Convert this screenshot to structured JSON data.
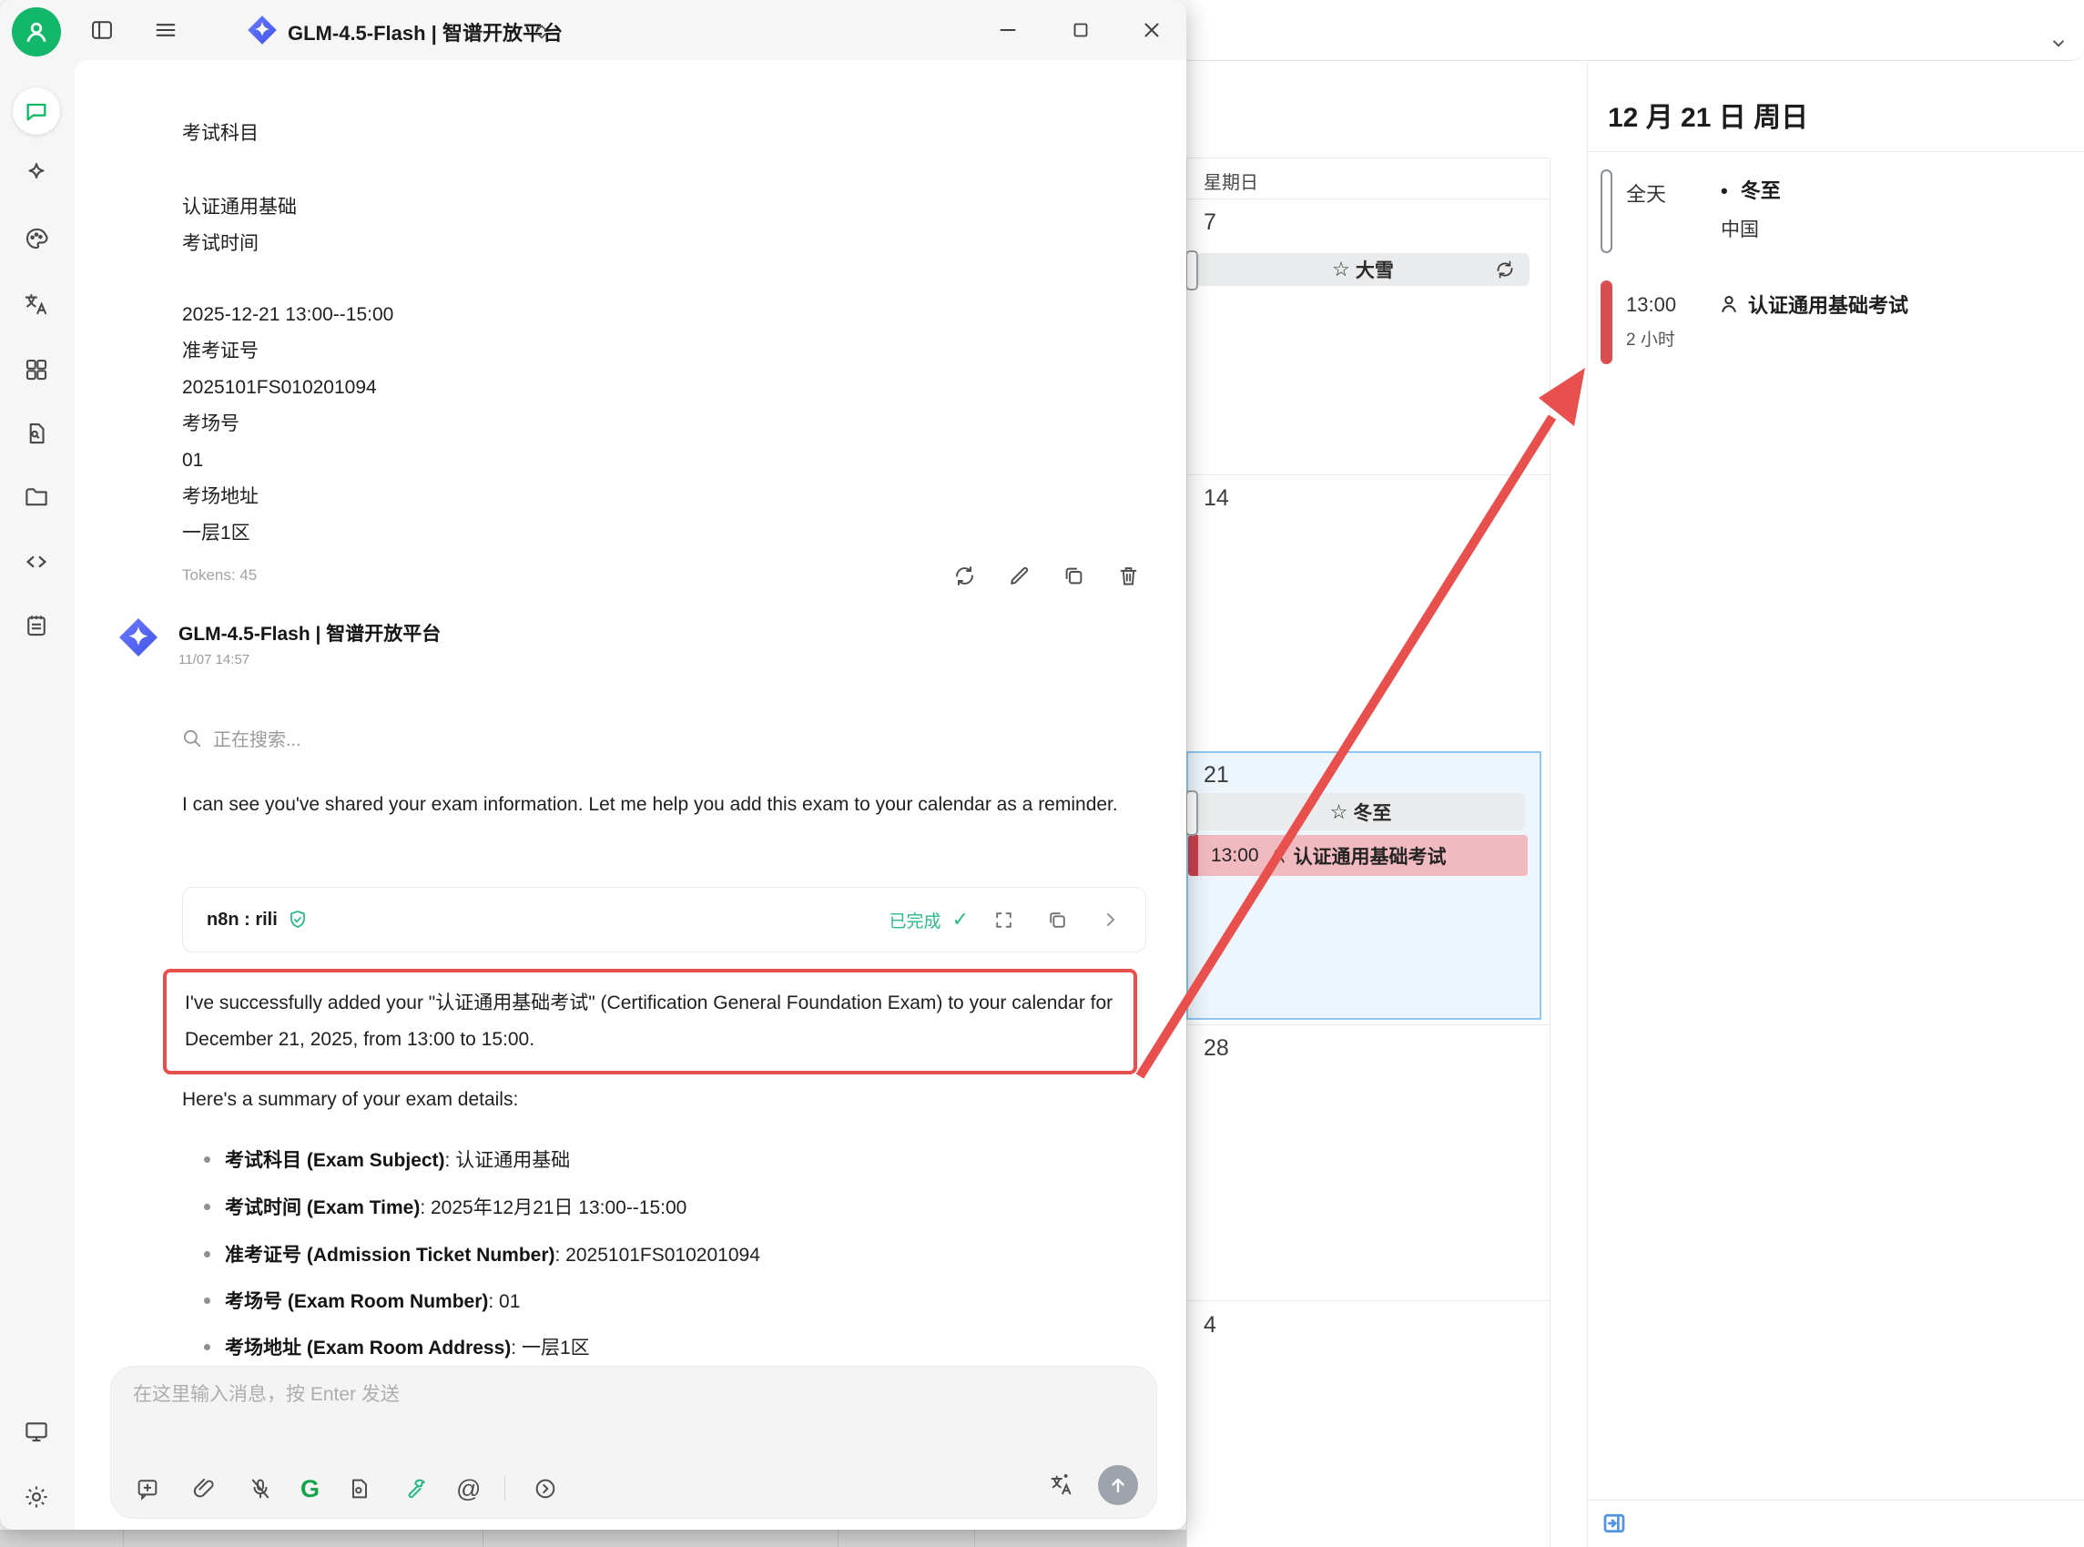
{
  "titlebar": {
    "app_title": "GLM-4.5-Flash | 智谱开放平台"
  },
  "chat": {
    "user": {
      "p1": "考试科目",
      "p2": "认证通用基础\n考试时间",
      "p3": "2025-12-21 13:00--15:00\n准考证号\n2025101FS010201094\n考场号\n01\n考场地址\n一层1区",
      "tokens": "Tokens: 45"
    },
    "assistant": {
      "name": "GLM-4.5-Flash | 智谱开放平台",
      "time": "11/07 14:57",
      "searching": "正在搜索...",
      "intro": "I can see you've shared your exam information. Let me help you add this exam to your calendar as a reminder.",
      "tool_name": "n8n : rili",
      "tool_status": "已完成",
      "check_mark": "✓",
      "highlight": "I've successfully added your \"认证通用基础考试\" (Certification General Foundation Exam) to your calendar for December 21, 2025, from 13:00 to 15:00.",
      "summary_heading": "Here's a summary of your exam details:",
      "summary": [
        {
          "label": "考试科目 (Exam Subject)",
          "value": ": 认证通用基础"
        },
        {
          "label": "考试时间 (Exam Time)",
          "value": ": 2025年12月21日 13:00--15:00"
        },
        {
          "label": "准考证号 (Admission Ticket Number)",
          "value": ": 2025101FS010201094"
        },
        {
          "label": "考场号 (Exam Room Number)",
          "value": ": 01"
        },
        {
          "label": "考场地址 (Exam Room Address)",
          "value": ": 一层1区"
        }
      ]
    },
    "input": {
      "placeholder": "在这里输入消息，按 Enter 发送"
    }
  },
  "calendar": {
    "weekday_header": "星期日",
    "day1": "7",
    "day2": "14",
    "day3": "21",
    "day4": "28",
    "day5": "4",
    "star": "☆",
    "daxue": "大雪",
    "dongzhi": "冬至",
    "exam_time": "13:00",
    "exam_title": "认证通用基础考试"
  },
  "panel": {
    "title": "12 月 21 日 周日",
    "allday_label": "全天",
    "holiday_bullet": "•",
    "holiday_title": "冬至",
    "holiday_region": "中国",
    "event_time": "13:00",
    "event_duration": "2 小时",
    "event_title": "认证通用基础考试"
  },
  "colors": {
    "annotation_red": "#e8504e",
    "exam_bar_red": "#c8414e",
    "exam_bg_pink": "#f1bac0",
    "highlight_border": "#8ec8f1",
    "highlight_bg": "#edf6fd",
    "success_green": "#2eb88a",
    "avatar_green": "#12b76a",
    "brand_blue": "#5a6cf3"
  }
}
